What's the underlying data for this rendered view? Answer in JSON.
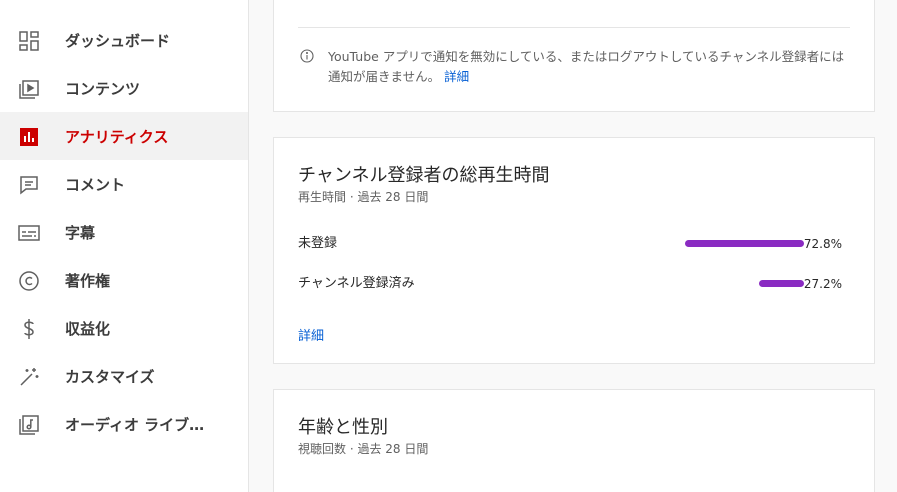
{
  "sidebar": {
    "items": [
      {
        "label": "ダッシュボード",
        "icon": "dashboard-icon",
        "active": false
      },
      {
        "label": "コンテンツ",
        "icon": "content-icon",
        "active": false
      },
      {
        "label": "アナリティクス",
        "icon": "analytics-icon",
        "active": true
      },
      {
        "label": "コメント",
        "icon": "comment-icon",
        "active": false
      },
      {
        "label": "字幕",
        "icon": "subtitles-icon",
        "active": false
      },
      {
        "label": "著作権",
        "icon": "copyright-icon",
        "active": false
      },
      {
        "label": "収益化",
        "icon": "monetization-icon",
        "active": false
      },
      {
        "label": "カスタマイズ",
        "icon": "customization-icon",
        "active": false
      },
      {
        "label": "オーディオ ライブ…",
        "icon": "audio-library-icon",
        "active": false
      }
    ]
  },
  "notice_card": {
    "text": "YouTube アプリで通知を無効にしている、またはログアウトしているチャンネル登録者には通知が届きません。",
    "link": "詳細"
  },
  "subscriber_watch_time": {
    "title": "チャンネル登録者の総再生時間",
    "subtitle": "再生時間 · 過去 28 日間",
    "rows": [
      {
        "label": "未登録",
        "value": "72.8%",
        "fraction": 0.728
      },
      {
        "label": "チャンネル登録済み",
        "value": "27.2%",
        "fraction": 0.272
      }
    ],
    "link": "詳細"
  },
  "age_gender": {
    "title": "年齢と性別",
    "subtitle": "視聴回数 · 過去 28 日間"
  },
  "colors": {
    "accent_red": "#cc0000",
    "bar_purple": "#8a2bc2",
    "link_blue": "#065fd4"
  }
}
